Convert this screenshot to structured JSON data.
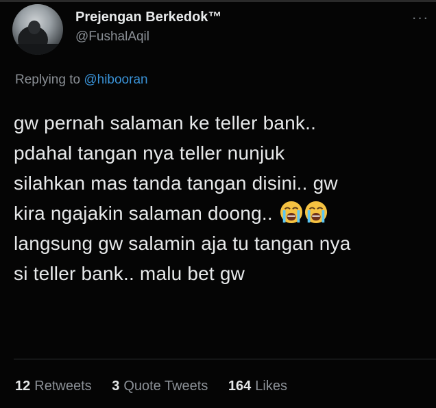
{
  "tweet": {
    "display_name": "Prejengan Berkedok™",
    "handle": "@FushalAqil",
    "more_icon": "more-dots-icon",
    "more_glyph": "···",
    "replying_prefix": "Replying to",
    "replying_to": "@hibooran",
    "text_lines": [
      "gw pernah salaman ke teller bank..",
      "pdahal tangan nya teller nunjuk",
      "silahkan mas tanda tangan disini.. gw",
      "kira ngajakin salaman doong..",
      "langsung gw salamin aja tu tangan nya",
      "si teller bank.. malu bet gw"
    ],
    "emojis": [
      "crying-face-emoji",
      "crying-face-emoji"
    ]
  },
  "stats": {
    "retweets_count": "12",
    "retweets_label": "Retweets",
    "quotes_count": "3",
    "quotes_label": "Quote Tweets",
    "likes_count": "164",
    "likes_label": "Likes"
  },
  "colors": {
    "background": "#050505",
    "text": "#e7e9ea",
    "muted": "#8b9096",
    "link": "#3a93d8"
  }
}
